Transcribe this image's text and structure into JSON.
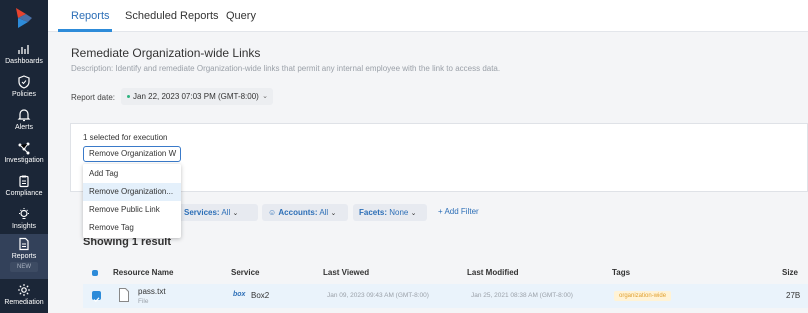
{
  "sidebar": {
    "items": [
      {
        "label": "Dashboards",
        "icon": "chart-icon"
      },
      {
        "label": "Policies",
        "icon": "shield-icon"
      },
      {
        "label": "Alerts",
        "icon": "bell-icon"
      },
      {
        "label": "Investigation",
        "icon": "graph-icon"
      },
      {
        "label": "Compliance",
        "icon": "clipboard-icon"
      },
      {
        "label": "Insights",
        "icon": "bulb-icon"
      },
      {
        "label": "Reports",
        "icon": "document-icon",
        "badge": "NEW"
      },
      {
        "label": "Remediation",
        "icon": "gear-icon"
      }
    ]
  },
  "tabs": [
    {
      "label": "Reports"
    },
    {
      "label": "Scheduled Reports"
    },
    {
      "label": "Query"
    }
  ],
  "report": {
    "title": "Remediate Organization-wide Links",
    "description": "Description: Identify and remediate Organization-wide links that permit any internal employee with the link to access data.",
    "date_label": "Report date:",
    "date_value": "Jan 22, 2023 07:03 PM (GMT-8:00)"
  },
  "execution": {
    "selected_text": "1 selected for execution",
    "action_value": "Remove Organization W"
  },
  "menu": {
    "items": [
      "Add Tag",
      "Remove Organization...",
      "Remove Public Link",
      "Remove Tag"
    ]
  },
  "filters": {
    "services_label": "Services:",
    "services_value": "All",
    "accounts_label": "Accounts:",
    "accounts_value": "All",
    "facets_label": "Facets:",
    "facets_value": "None",
    "add_filter": "+ Add Filter"
  },
  "results_text": "Showing 1 result",
  "table": {
    "headers": [
      "Resource Name",
      "Service",
      "Last Viewed",
      "Last Modified",
      "Tags",
      "Size"
    ],
    "rows": [
      {
        "name": "pass.txt",
        "type": "File",
        "service_logo": "box",
        "service": "Box2",
        "last_viewed": "Jan 09, 2023 09:43 AM (GMT-8:00)",
        "last_modified": "Jan 25, 2021 08:38 AM (GMT-8:00)",
        "tag": "organization-wide",
        "size": "27B"
      }
    ]
  },
  "colors": {
    "sidebar": "#1b2637",
    "accent": "#2d8bd9",
    "link": "#2d6fb7",
    "tag_bg": "#fff3d6",
    "tag_text": "#e0a030"
  }
}
